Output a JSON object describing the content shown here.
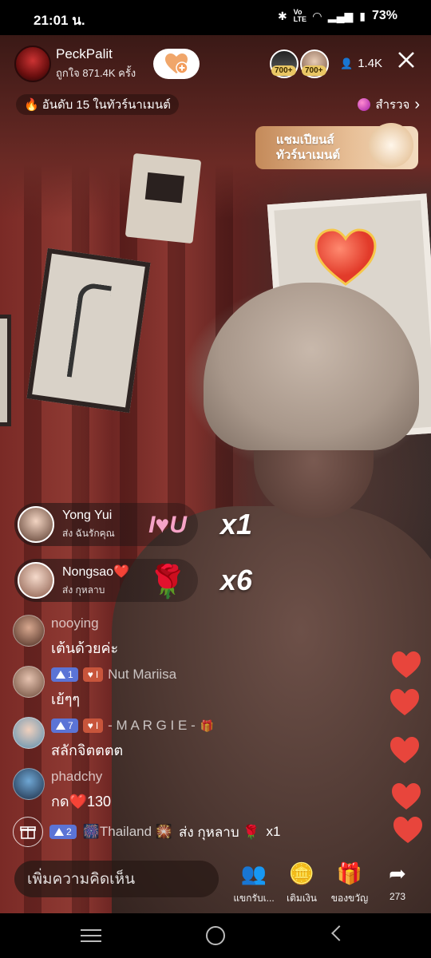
{
  "status_bar": {
    "time": "21:01 น.",
    "battery": "73%",
    "network": "VoLTE"
  },
  "host": {
    "name": "PeckPalit",
    "likes": "ถูกใจ 871.4K ครั้ง",
    "follow_icon": "heart-plus-icon"
  },
  "viewers": {
    "badges": [
      "700+",
      "700+"
    ],
    "count": "1.4K"
  },
  "rank": {
    "fire_icon": "🔥",
    "text": "อันดับ 15 ในทัวร์นาเมนต์"
  },
  "explore": {
    "label": "สำรวจ",
    "chevron": "›"
  },
  "champion_banner": {
    "line1": "แชมเปียนส์",
    "line2": "ทัวร์นาเมนต์"
  },
  "gifts": [
    {
      "user": "Yong Yui",
      "action": "ส่ง ฉันรักคุณ",
      "gift_icon": "i-love-you-icon",
      "count": "x1"
    },
    {
      "user": "Nongsao❤️",
      "action": "ส่ง กุหลาบ",
      "gift_icon": "rose-icon",
      "count": "x6"
    }
  ],
  "comments": [
    {
      "user": "nooying",
      "text": "เต้นด้วยค่ะ",
      "level": null,
      "fan": null
    },
    {
      "user": "Nut Mariisa",
      "text": "เย้ๆๆ",
      "level": "1",
      "fan": "I"
    },
    {
      "user": "- M A R G I E -",
      "text": "สลักจิตตตต",
      "level": "7",
      "fan": "I"
    },
    {
      "user": "phadchy",
      "text": "กด❤️130",
      "level": null,
      "fan": null
    }
  ],
  "system_message": {
    "level": "2",
    "user": "🎆Thailand 🎇",
    "action": "ส่ง กุหลาบ 🌹",
    "count": "x1"
  },
  "bottom": {
    "comment_placeholder": "เพิ่มความคิดเห็น",
    "actions": [
      {
        "label": "แขกรับเ...",
        "icon": "guests-icon",
        "glyph": "👥"
      },
      {
        "label": "เติมเงิน",
        "icon": "coin-icon",
        "glyph": "🪙"
      },
      {
        "label": "ของขวัญ",
        "icon": "gift-icon",
        "glyph": "🎁"
      },
      {
        "label": "273",
        "icon": "share-icon",
        "glyph": "➦"
      }
    ]
  },
  "colors": {
    "heart": "#e8453c",
    "level_blue": "#5b74d6",
    "fan_orange": "#c8553b",
    "champ_banner": "#c48a5a"
  }
}
